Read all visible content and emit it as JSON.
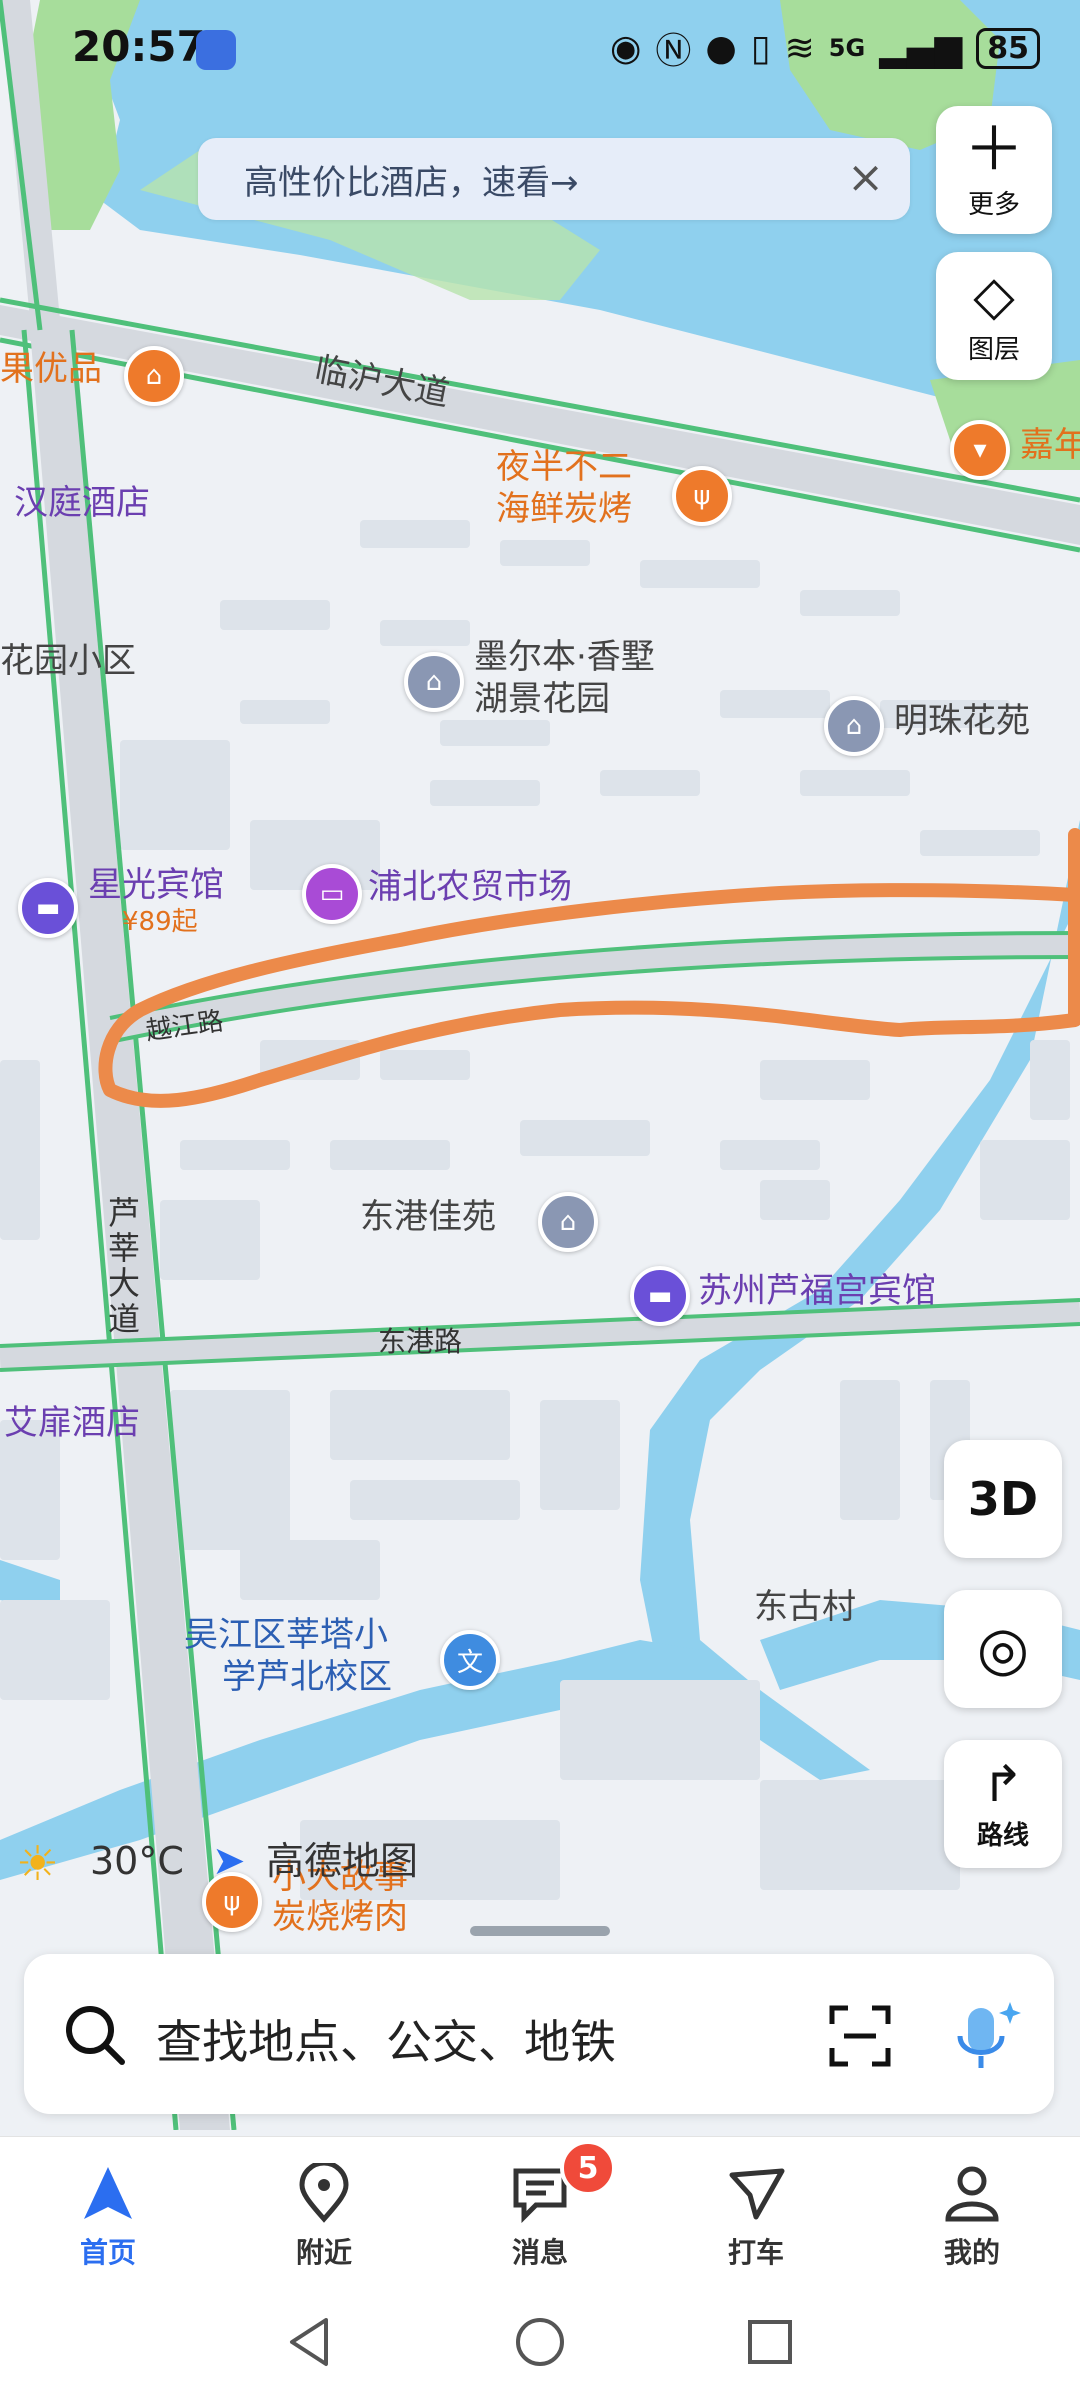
{
  "status_bar": {
    "time": "20:57",
    "network": "5G",
    "battery": "85"
  },
  "banner": {
    "text": "高性价比酒店，速看→",
    "close": "×"
  },
  "side_buttons": {
    "more": "更多",
    "layers": "图层",
    "three_d": "3D",
    "route": "路线"
  },
  "map": {
    "roads": {
      "linhu": "临沪大道",
      "yuejiang": "越江路",
      "lusheng": "芦莘大道",
      "donggang": "东港路"
    },
    "places": {
      "guoyoupin": "果优品",
      "hanting": "汉庭酒店",
      "yeban": "夜半不二",
      "yeban_sub": "海鲜炭烤",
      "jia": "嘉年",
      "huayuan": "花园小区",
      "moerben": "墨尔本·香墅",
      "moerben_sub": "湖景花园",
      "mingzhu": "明珠花苑",
      "xingguang": "星光宾馆",
      "xingguang_price": "¥89起",
      "pubei": "浦北农贸市场",
      "donggang_jiayuan": "东港佳苑",
      "lufugong": "苏州芦福宫宾馆",
      "aifei": "艾扉酒店",
      "donggu": "东古村",
      "school": "吴江区莘塔小",
      "school_sub": "学芦北校区",
      "xiaoxiao": "小大故事",
      "xiaoxiao_sub": "炭烧烤肉"
    },
    "weather": "30°C",
    "brand": "高德地图"
  },
  "search": {
    "placeholder": "查找地点、公交、地铁"
  },
  "tabs": [
    {
      "label": "首页"
    },
    {
      "label": "附近"
    },
    {
      "label": "消息"
    },
    {
      "label": "打车"
    },
    {
      "label": "我的"
    }
  ],
  "messages_badge": "5",
  "colors": {
    "water": "#8fd0ee",
    "green": "#a7dd9b",
    "road_edge": "#4fc07a",
    "drawn_stroke": "#ec8a4a",
    "accent": "#2b6ef0"
  }
}
